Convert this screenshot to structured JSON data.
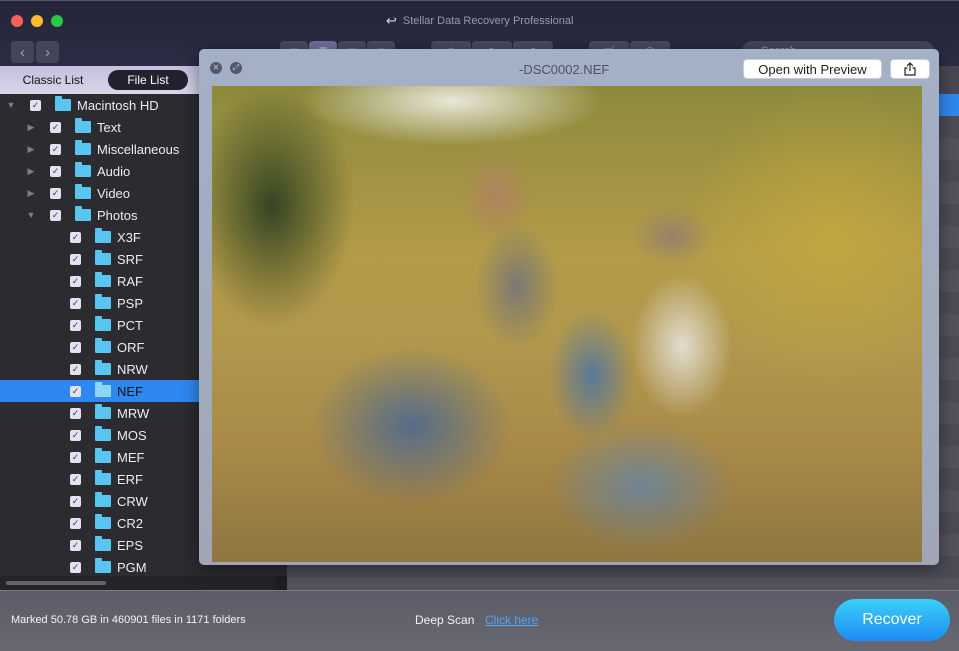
{
  "window": {
    "title": "Stellar Data Recovery Professional"
  },
  "toolbar": {
    "back_label": "‹",
    "forward_label": "›",
    "view_buttons": [
      {
        "name": "icon-view",
        "glyph": "▦",
        "active": false
      },
      {
        "name": "list-view",
        "glyph": "☰",
        "active": true
      },
      {
        "name": "column-view",
        "glyph": "▥",
        "active": false
      },
      {
        "name": "coverflow-view",
        "glyph": "⊟",
        "active": false
      }
    ],
    "settings_glyph": "⚙",
    "history_glyph": "↺▾",
    "help_glyph": "?",
    "cart_glyph": "🛒",
    "account_glyph": "◯",
    "search": {
      "placeholder": "Search",
      "value": ""
    }
  },
  "sidebar": {
    "tabs": [
      {
        "label": "Classic List",
        "active": false
      },
      {
        "label": "File List",
        "active": true
      }
    ],
    "tree": [
      {
        "label": "Macintosh HD",
        "level": 0,
        "expanded": true,
        "checked": true,
        "selected": false
      },
      {
        "label": "Text",
        "level": 1,
        "expanded": false,
        "checked": true,
        "selected": false
      },
      {
        "label": "Miscellaneous",
        "level": 1,
        "expanded": false,
        "checked": true,
        "selected": false
      },
      {
        "label": "Audio",
        "level": 1,
        "expanded": false,
        "checked": true,
        "selected": false
      },
      {
        "label": "Video",
        "level": 1,
        "expanded": false,
        "checked": true,
        "selected": false
      },
      {
        "label": "Photos",
        "level": 1,
        "expanded": true,
        "checked": true,
        "selected": false
      },
      {
        "label": "X3F",
        "level": 2,
        "checked": true,
        "selected": false
      },
      {
        "label": "SRF",
        "level": 2,
        "checked": true,
        "selected": false
      },
      {
        "label": "RAF",
        "level": 2,
        "checked": true,
        "selected": false
      },
      {
        "label": "PSP",
        "level": 2,
        "checked": true,
        "selected": false
      },
      {
        "label": "PCT",
        "level": 2,
        "checked": true,
        "selected": false
      },
      {
        "label": "ORF",
        "level": 2,
        "checked": true,
        "selected": false
      },
      {
        "label": "NRW",
        "level": 2,
        "checked": true,
        "selected": false
      },
      {
        "label": "NEF",
        "level": 2,
        "checked": true,
        "selected": true
      },
      {
        "label": "MRW",
        "level": 2,
        "checked": true,
        "selected": false
      },
      {
        "label": "MOS",
        "level": 2,
        "checked": true,
        "selected": false
      },
      {
        "label": "MEF",
        "level": 2,
        "checked": true,
        "selected": false
      },
      {
        "label": "ERF",
        "level": 2,
        "checked": true,
        "selected": false
      },
      {
        "label": "CRW",
        "level": 2,
        "checked": true,
        "selected": false
      },
      {
        "label": "CR2",
        "level": 2,
        "checked": true,
        "selected": false
      },
      {
        "label": "EPS",
        "level": 2,
        "checked": true,
        "selected": false
      },
      {
        "label": "PGM",
        "level": 2,
        "checked": true,
        "selected": false
      }
    ]
  },
  "preview": {
    "filename": "-DSC0002.NEF",
    "open_button": "Open with Preview",
    "share_glyph": "⇧",
    "close_glyph": "✕",
    "fullscreen_glyph": "⤢",
    "image_description": "Family photo: man, young girl and woman in hat sitting in autumn grass"
  },
  "status": {
    "summary": "Marked 50.78 GB in 460901 files in 1171 folders",
    "deep_scan_label": "Deep Scan",
    "deep_scan_link": "Click here",
    "recover_button": "Recover"
  },
  "colors": {
    "accent": "#2f88f0",
    "folder": "#59c6f2",
    "recover_top": "#3ad0f8",
    "recover_bottom": "#1e8cf4",
    "link": "#4aa6ff"
  }
}
